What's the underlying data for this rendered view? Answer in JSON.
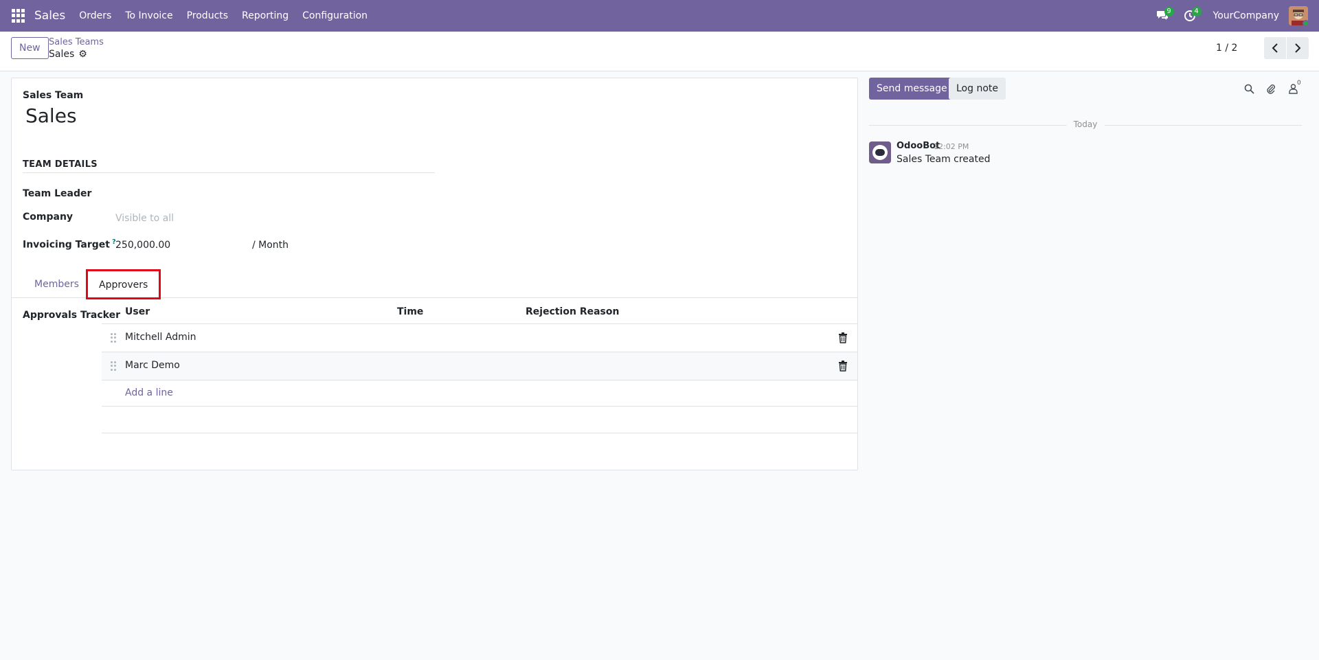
{
  "navbar": {
    "brand": "Sales",
    "menu": [
      "Orders",
      "To Invoice",
      "Products",
      "Reporting",
      "Configuration"
    ],
    "messages_badge": "9",
    "activities_badge": "4",
    "company": "YourCompany"
  },
  "control_panel": {
    "new_label": "New",
    "breadcrumb": "Sales Teams",
    "record": "Sales",
    "pager": "1 / 2"
  },
  "form": {
    "title_label": "Sales Team",
    "title": "Sales",
    "group_title": "TEAM DETAILS",
    "team_leader_label": "Team Leader",
    "company_label": "Company",
    "company_placeholder": "Visible to all",
    "invoicing_target_label": "Invoicing Target",
    "invoicing_target_help": "?",
    "invoicing_target_value": "250,000.00",
    "invoicing_target_suffix": "/ Month",
    "tabs": [
      "Members",
      "Approvers"
    ],
    "active_tab": "Approvers",
    "tracker_label": "Approvals Tracker",
    "columns": [
      "User",
      "Time",
      "Rejection Reason"
    ],
    "rows": [
      {
        "user": "Mitchell Admin",
        "time": "",
        "reason": ""
      },
      {
        "user": "Marc Demo",
        "time": "",
        "reason": ""
      }
    ],
    "add_line": "Add a line"
  },
  "chatter": {
    "send_message": "Send message",
    "log_note": "Log note",
    "followers_count": "0",
    "date_separator": "Today",
    "message": {
      "author": "OdooBot",
      "time": "12:02 PM",
      "body": "Sales Team created"
    }
  },
  "colors": {
    "brand": "#71639e",
    "badge": "#28a745",
    "highlight": "#e0071b"
  }
}
